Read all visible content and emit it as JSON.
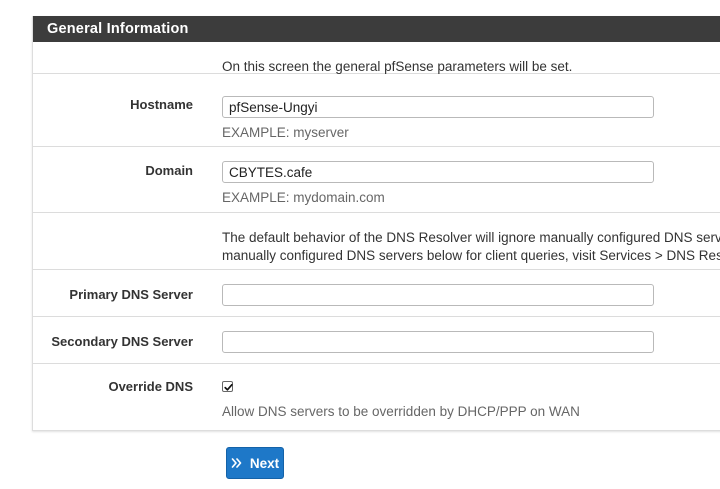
{
  "panel": {
    "title": "General Information"
  },
  "intro": {
    "text": "On this screen the general pfSense parameters will be set."
  },
  "hostname": {
    "label": "Hostname",
    "value": "pfSense-Ungyi",
    "help": "EXAMPLE: myserver"
  },
  "domain": {
    "label": "Domain",
    "value": "CBYTES.cafe",
    "help": "EXAMPLE: mydomain.com"
  },
  "dns_note": {
    "line1": "The default behavior of the DNS Resolver will ignore manually configured DNS servers",
    "line2": "manually configured DNS servers below for client queries, visit Services > DNS Resolver"
  },
  "primary_dns": {
    "label": "Primary DNS Server",
    "value": ""
  },
  "secondary_dns": {
    "label": "Secondary DNS Server",
    "value": ""
  },
  "override_dns": {
    "label": "Override DNS",
    "checked": true,
    "help": "Allow DNS servers to be overridden by DHCP/PPP on WAN"
  },
  "next_button": {
    "label": "Next",
    "icon": "double-chevron-right-icon"
  },
  "colors": {
    "heading_bg": "#3c3c3c",
    "button_bg": "#1e78c8"
  }
}
